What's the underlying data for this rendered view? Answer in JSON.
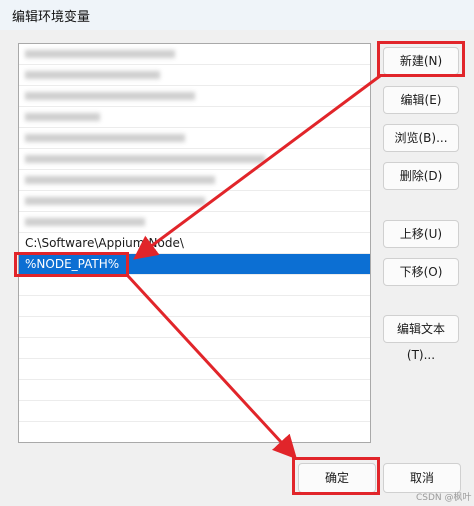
{
  "window": {
    "title": "编辑环境变量"
  },
  "list": {
    "entries": [
      {
        "text": "C:\\Software\\Appium\\Node\\",
        "selected": false
      },
      {
        "text": "%NODE_PATH%",
        "selected": true
      }
    ]
  },
  "buttons": {
    "new": "新建(N)",
    "edit": "编辑(E)",
    "browse": "浏览(B)...",
    "delete": "删除(D)",
    "move_up": "上移(U)",
    "move_down": "下移(O)",
    "edit_text": "编辑文本(T)...",
    "ok": "确定",
    "cancel": "取消"
  },
  "watermark": "CSDN @枫叶",
  "colors": {
    "selection": "#0c6fd3",
    "highlight": "#e1252a"
  }
}
